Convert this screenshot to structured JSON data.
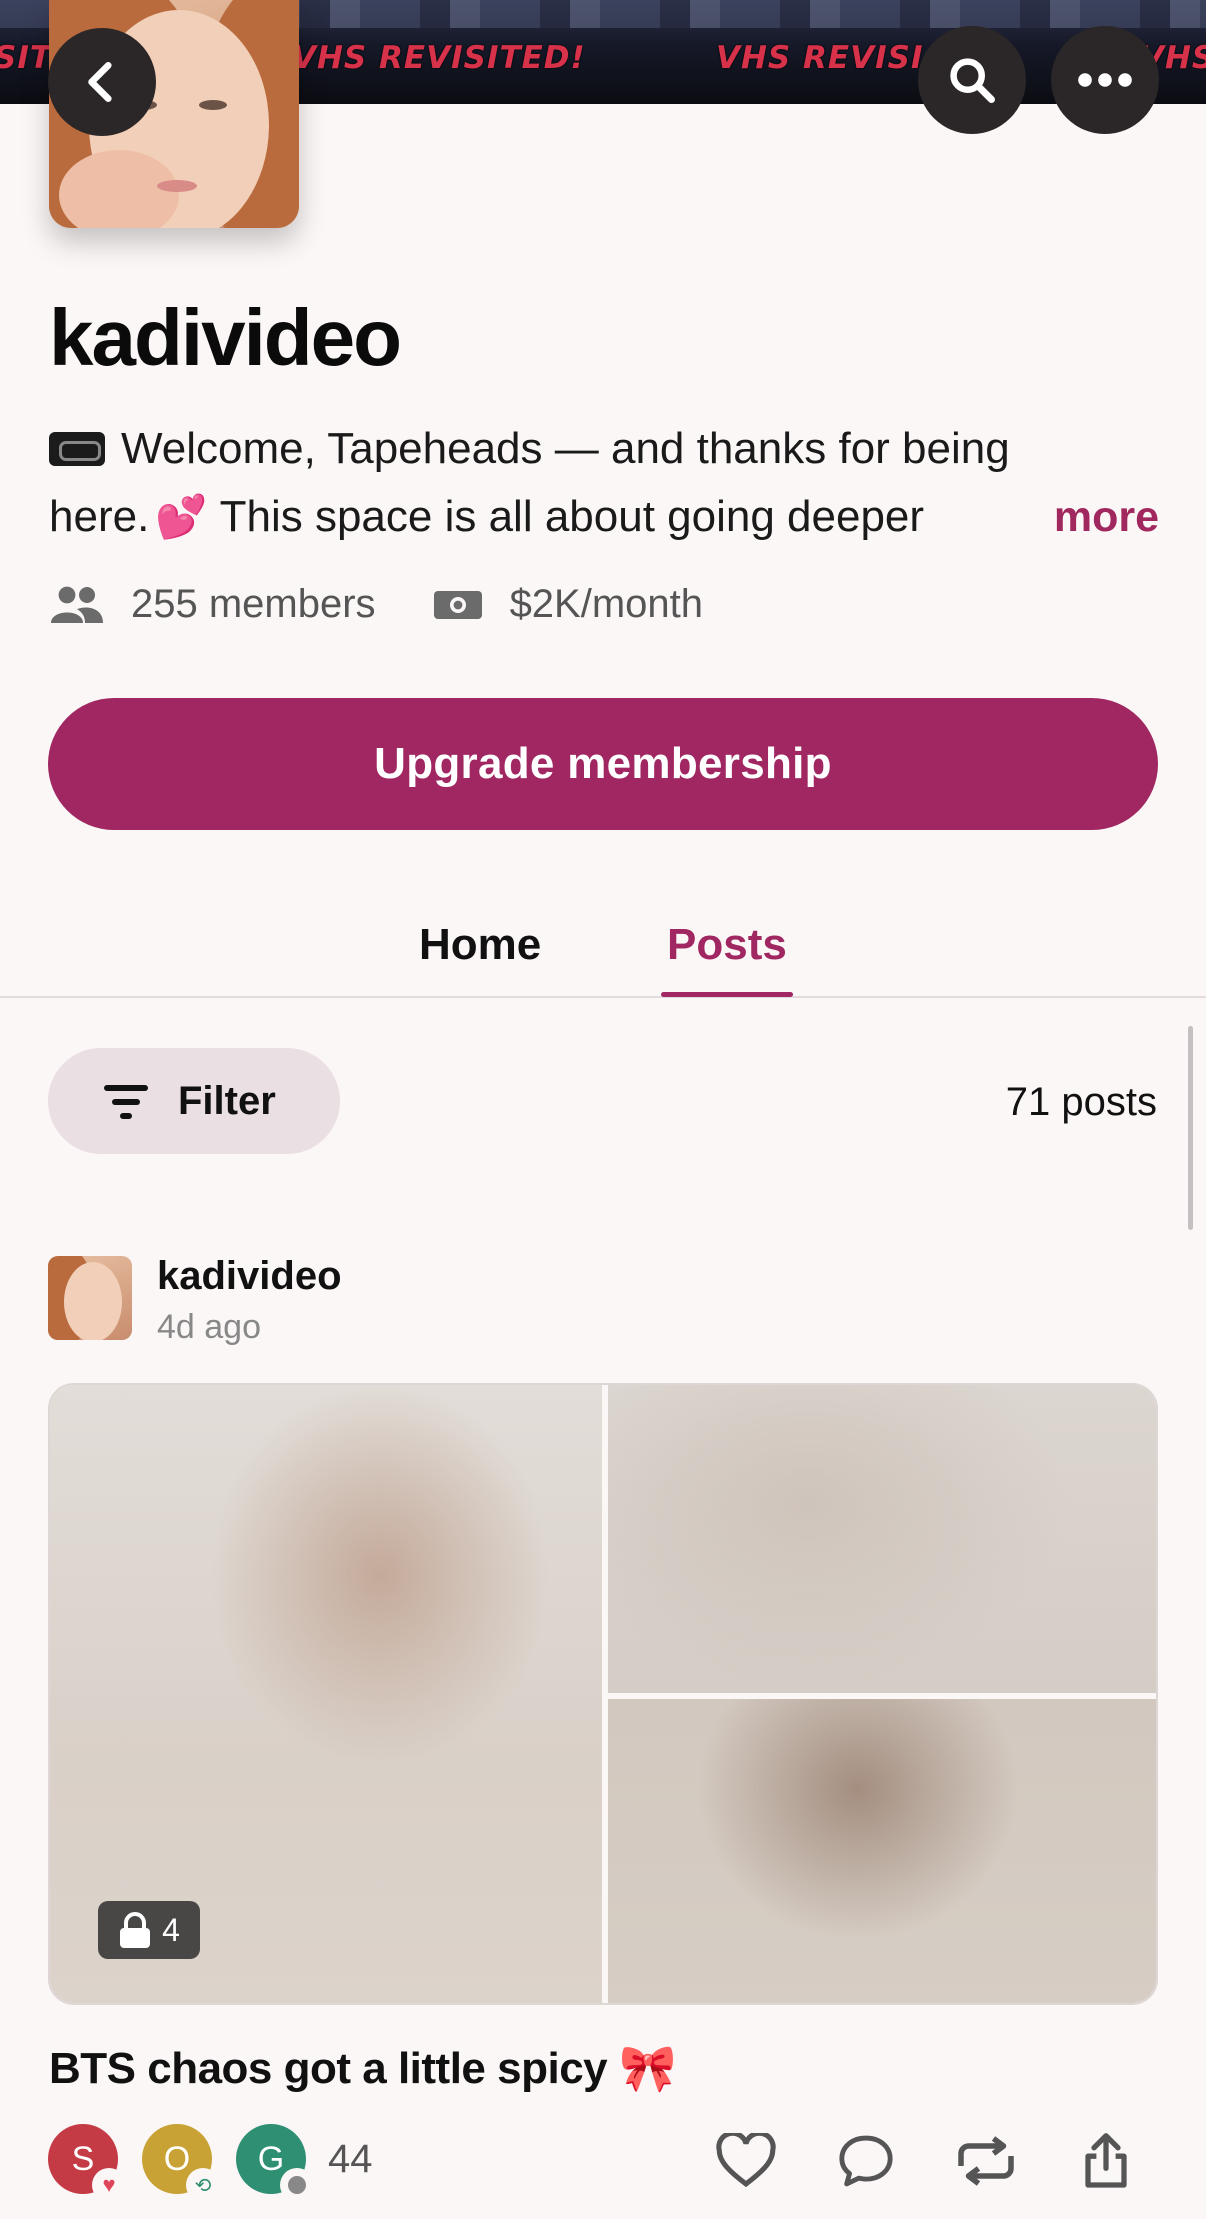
{
  "banner": {
    "texts": [
      "SITE",
      "VHS REVISITED!",
      "VHS REVISI",
      "VHS"
    ]
  },
  "header": {
    "back_icon": "chevron-left-icon",
    "search_icon": "search-icon",
    "more_icon": "ellipsis-icon"
  },
  "creator": {
    "name": "kadivideo",
    "description_line1": "Welcome, Tapeheads — and thanks for being",
    "description_line2_a": "here.",
    "description_line2_b": "This space is all about going deeper",
    "more_label": "more",
    "members": "255 members",
    "earnings": "$2K/month"
  },
  "upgrade": {
    "label": "Upgrade membership"
  },
  "tabs": [
    {
      "label": "Home",
      "active": false
    },
    {
      "label": "Posts",
      "active": true
    }
  ],
  "filter": {
    "label": "Filter",
    "count": "71 posts"
  },
  "post": {
    "author": "kadivideo",
    "time": "4d ago",
    "locked_count": "4",
    "title": "BTS chaos got a little spicy",
    "reactors": [
      "S",
      "O",
      "G"
    ],
    "reaction_count": "44"
  },
  "colors": {
    "accent": "#a02762",
    "background": "#fcf7f7"
  }
}
